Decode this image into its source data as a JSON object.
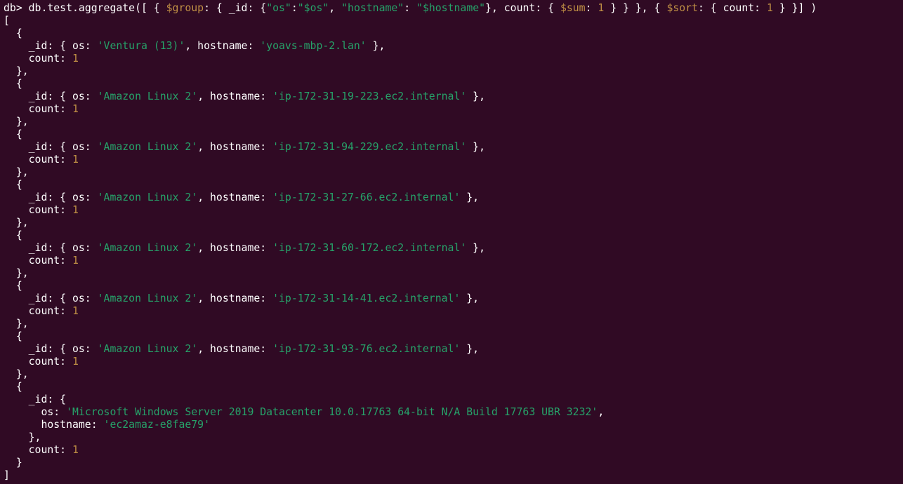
{
  "prompt": "db>",
  "command": {
    "p1": " db.test.aggregate([ { ",
    "group_op": "$group",
    "p2": ": { _id: {",
    "str_os_key": "\"os\"",
    "p3": ":",
    "str_os_val": "\"$os\"",
    "p4": ", ",
    "str_host_key": "\"hostname\"",
    "p5": ": ",
    "str_host_val": "\"$hostname\"",
    "p6": "}, count: { ",
    "sum_op": "$sum",
    "p7": ": ",
    "sum_val": "1",
    "p8": " } } }, { ",
    "sort_op": "$sort",
    "p9": ": { count: ",
    "sort_val": "1",
    "p10": " } }] )"
  },
  "open_bracket": "[",
  "close_bracket": "]",
  "results": [
    {
      "os": "'Ventura (13)'",
      "hostname": "'yoavs-mbp-2.lan'",
      "count": "1"
    },
    {
      "os": "'Amazon Linux 2'",
      "hostname": "'ip-172-31-19-223.ec2.internal'",
      "count": "1"
    },
    {
      "os": "'Amazon Linux 2'",
      "hostname": "'ip-172-31-94-229.ec2.internal'",
      "count": "1"
    },
    {
      "os": "'Amazon Linux 2'",
      "hostname": "'ip-172-31-27-66.ec2.internal'",
      "count": "1"
    },
    {
      "os": "'Amazon Linux 2'",
      "hostname": "'ip-172-31-60-172.ec2.internal'",
      "count": "1"
    },
    {
      "os": "'Amazon Linux 2'",
      "hostname": "'ip-172-31-14-41.ec2.internal'",
      "count": "1"
    },
    {
      "os": "'Amazon Linux 2'",
      "hostname": "'ip-172-31-93-76.ec2.internal'",
      "count": "1"
    }
  ],
  "last_result": {
    "os": "'Microsoft Windows Server 2019 Datacenter 10.0.17763 64-bit N/A Build 17763 UBR 3232'",
    "hostname": "'ec2amaz-e8fae79'",
    "count": "1"
  },
  "colors": {
    "background": "#300a24",
    "text": "#ffffff",
    "string": "#26a269",
    "number": "#c09045"
  }
}
